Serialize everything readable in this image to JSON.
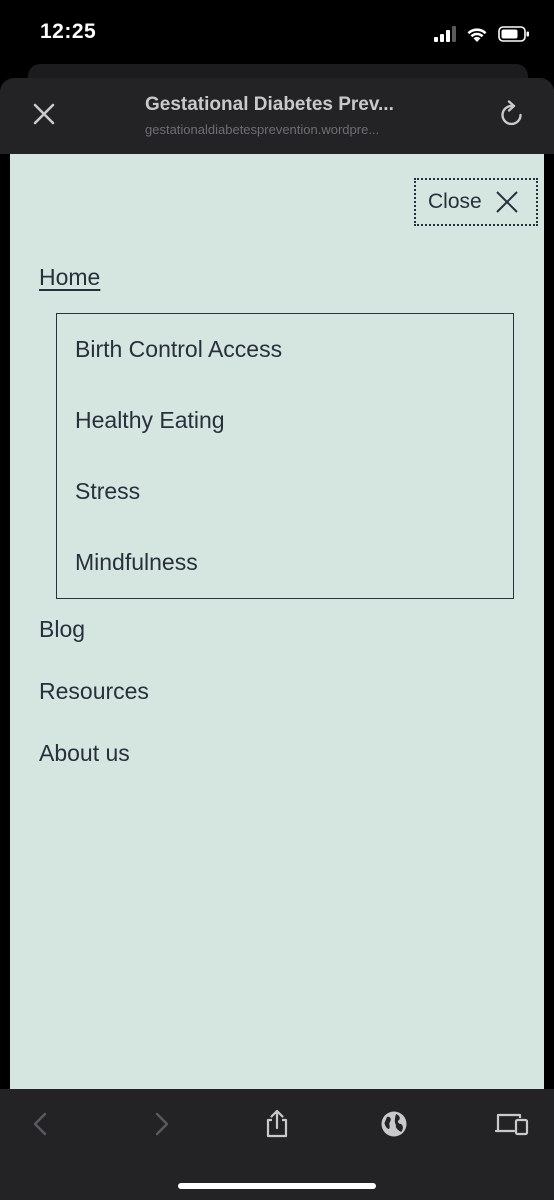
{
  "status": {
    "time": "12:25"
  },
  "browser": {
    "title": "Gestational Diabetes Prev...",
    "url": "gestationaldiabetesprevention.wordpre..."
  },
  "menu": {
    "close_label": "Close",
    "home": "Home",
    "submenu": [
      "Birth Control Access",
      "Healthy Eating",
      "Stress",
      "Mindfulness"
    ],
    "items": [
      "Blog",
      "Resources",
      "About us"
    ]
  },
  "colors": {
    "content_bg": "#d5e5e0",
    "text": "#28303d",
    "chrome": "#232325"
  }
}
